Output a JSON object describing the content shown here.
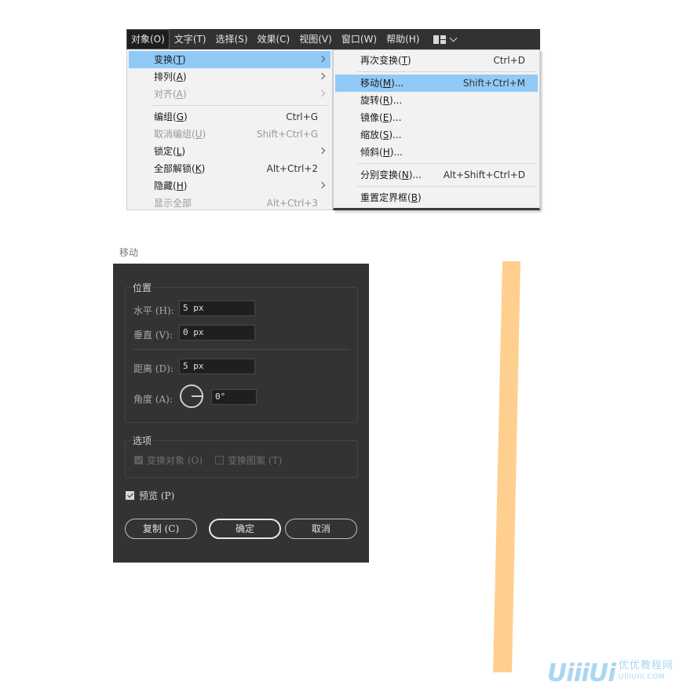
{
  "menubar": {
    "items": [
      {
        "label": "对象(O)",
        "active": true
      },
      {
        "label": "文字(T)"
      },
      {
        "label": "选择(S)"
      },
      {
        "label": "效果(C)"
      },
      {
        "label": "视图(V)"
      },
      {
        "label": "窗口(W)"
      },
      {
        "label": "帮助(H)"
      }
    ],
    "layout_icon": "workspace-grid-icon",
    "chevron_icon": "chevron-down-icon"
  },
  "object_menu": {
    "items": [
      {
        "label": "变换",
        "key": "T",
        "submenu": true,
        "highlighted": true
      },
      {
        "label": "排列",
        "key": "A",
        "submenu": true
      },
      {
        "label": "对齐",
        "key": "A",
        "submenu": true,
        "disabled": true
      },
      {
        "label": "编组",
        "key": "G",
        "shortcut": "Ctrl+G"
      },
      {
        "label": "取消编组",
        "key": "U",
        "shortcut": "Shift+Ctrl+G",
        "disabled": true
      },
      {
        "label": "锁定",
        "key": "L",
        "submenu": true
      },
      {
        "label": "全部解锁",
        "key": "K",
        "shortcut": "Alt+Ctrl+2"
      },
      {
        "label": "隐藏",
        "key": "H",
        "submenu": true
      },
      {
        "label": "显示全部",
        "shortcut": "Alt+Ctrl+3",
        "disabled": true
      }
    ]
  },
  "transform_menu": {
    "items": [
      {
        "label": "再次变换",
        "key": "T",
        "shortcut": "Ctrl+D"
      },
      {
        "label": "移动",
        "key": "M",
        "suffix": "...",
        "shortcut": "Shift+Ctrl+M",
        "highlighted": true
      },
      {
        "label": "旋转",
        "key": "R",
        "suffix": "..."
      },
      {
        "label": "镜像",
        "key": "E",
        "suffix": "..."
      },
      {
        "label": "缩放",
        "key": "S",
        "suffix": "..."
      },
      {
        "label": "倾斜",
        "key": "H",
        "suffix": "..."
      },
      {
        "label": "分别变换",
        "key": "N",
        "suffix": "...",
        "shortcut": "Alt+Shift+Ctrl+D"
      },
      {
        "label": "重置定界框",
        "key": "B"
      }
    ]
  },
  "move_dialog": {
    "title": "移动",
    "position_group": "位置",
    "horizontal_label": "水平 (H):",
    "horizontal_value": "5 px",
    "vertical_label": "垂直 (V):",
    "vertical_value": "0 px",
    "distance_label": "距离 (D):",
    "distance_value": "5 px",
    "angle_label": "角度 (A):",
    "angle_value": "0°",
    "options_group": "选项",
    "transform_objects_label": "变换对象 (O)",
    "transform_objects_checked": true,
    "transform_patterns_label": "变换图案 (T)",
    "transform_patterns_checked": false,
    "preview_label": "预览 (P)",
    "preview_checked": true,
    "copy_button": "复制 (C)",
    "ok_button": "确定",
    "cancel_button": "取消"
  },
  "canvas": {
    "strip_color": "#FFCF8F"
  },
  "watermark": {
    "logo": "UiiiUi",
    "site_name": "优优教程网",
    "url": "UIIIUIII.COM"
  },
  "colors": {
    "menubar_bg": "#323232",
    "menu_bg": "#F2F2F2",
    "menu_highlight": "#91C9F7",
    "dialog_bg": "#333333"
  }
}
